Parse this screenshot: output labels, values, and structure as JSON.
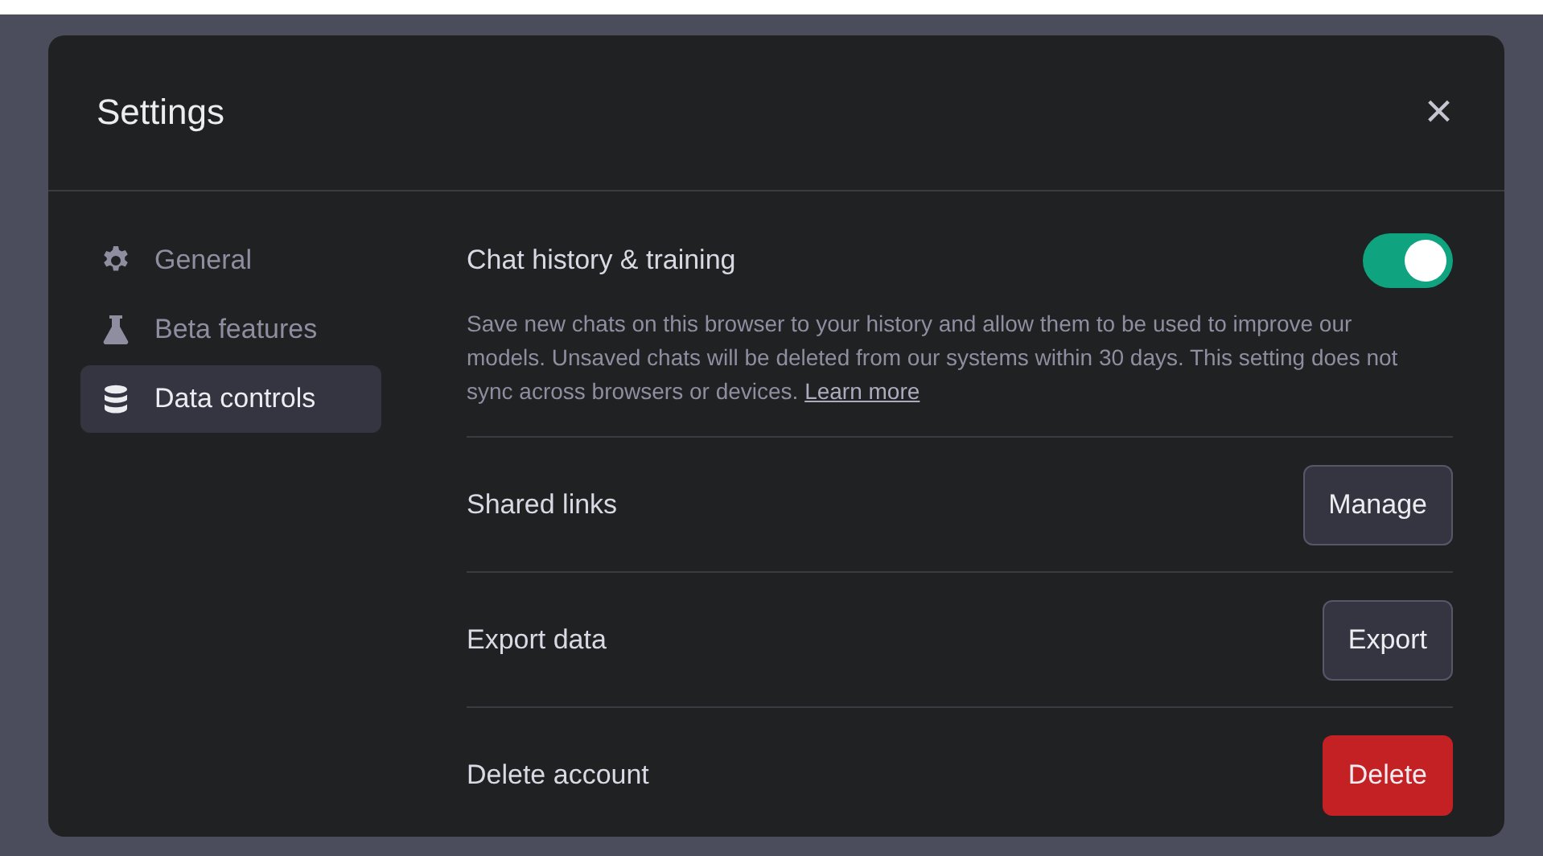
{
  "dialog": {
    "title": "Settings",
    "close": "×"
  },
  "sidebar": {
    "items": [
      {
        "label": "General",
        "selected": false
      },
      {
        "label": "Beta features",
        "selected": false
      },
      {
        "label": "Data controls",
        "selected": true
      }
    ]
  },
  "rows": [
    {
      "kind": "toggle",
      "label": "Chat history & training",
      "on": true,
      "description": "Save new chats on this browser to your history and allow them to be used to improve our models. Unsaved chats will be deleted from our systems within 30 days. This setting does not sync across browsers or devices.",
      "link": "Learn more"
    },
    {
      "kind": "button",
      "label": "Shared links",
      "button": "Manage"
    },
    {
      "kind": "button",
      "label": "Export data",
      "button": "Export"
    },
    {
      "kind": "danger",
      "label": "Delete account",
      "button": "Delete"
    }
  ]
}
